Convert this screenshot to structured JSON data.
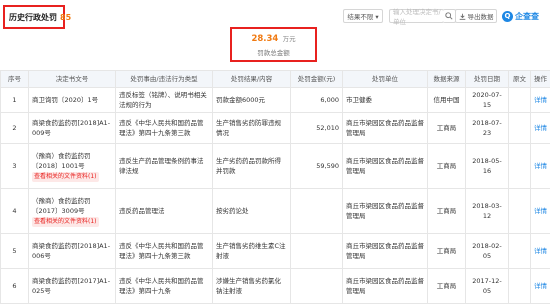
{
  "header": {
    "title": "历史行政处罚",
    "count": "85",
    "sort_label": "结果不限 ▾",
    "search_placeholder": "输入处理决定书/单位",
    "search_icon": "search-icon",
    "export_label": "导出数据",
    "logo_text": "企查查"
  },
  "summary": {
    "amount": "28.34",
    "unit": "万元",
    "label": "罚款总金额"
  },
  "table": {
    "columns": [
      "序号",
      "决定书文号",
      "处罚事由/违法行为类型",
      "处罚结果/内容",
      "处罚金额(元)",
      "处罚单位",
      "数据来源",
      "处罚日期",
      "原文",
      "操作"
    ],
    "rows": [
      {
        "no": "1",
        "doc": "商卫询罚〔2020〕1号",
        "doc_tag": "",
        "reason": "违反标签（铭牌）、说明书相关法规的行为",
        "result": "罚款金额6000元",
        "amount": "6,000",
        "unit": "市卫健委",
        "source": "信用中国",
        "date": "2020-07-15",
        "orig": "",
        "op": "详情"
      },
      {
        "no": "2",
        "doc": "商梁食药监药罚[2018]A1-009号",
        "doc_tag": "",
        "reason": "违反《中华人民共和国药品管理法》第四十九条第三款",
        "result": "生产销售劣药防罪违规情况",
        "amount": "52,010",
        "unit": "商丘市梁园区食品药品监督管理局",
        "source": "工商局",
        "date": "2018-07-23",
        "orig": "",
        "op": "详情"
      },
      {
        "no": "3",
        "doc": "（豫商）食药监药罚〔2018〕1001号",
        "doc_tag": "查看相关的文件资料(1)",
        "reason": "违反生产药品管理条例药事法律法规",
        "result": "生产劣药药品罚款所得并罚款",
        "amount": "59,590",
        "unit": "商丘市梁园区食品药品监督管理局",
        "source": "工商局",
        "date": "2018-05-16",
        "orig": "",
        "op": "详情"
      },
      {
        "no": "4",
        "doc": "（豫商）食药监药罚〔2017〕3009号",
        "doc_tag": "查看相关的文件资料(1)",
        "reason": "违反药品管理法",
        "result": "按劣药论处",
        "amount": "",
        "unit": "商丘市梁园区食品药品监督管理局",
        "source": "工商局",
        "date": "2018-03-12",
        "orig": "",
        "op": "详情"
      },
      {
        "no": "5",
        "doc": "商梁食药监药罚[2018]A1-006号",
        "doc_tag": "",
        "reason": "违反《中华人民共和国药品管理法》第四十九条第三款",
        "result": "生产销售劣药维生素C注射液",
        "amount": "",
        "unit": "商丘市梁园区食品药品监督管理局",
        "source": "工商局",
        "date": "2018-02-05",
        "orig": "",
        "op": "详情"
      },
      {
        "no": "6",
        "doc": "商梁食药监药罚[2017]A1-025号",
        "doc_tag": "",
        "reason": "违反《中华人民共和国药品管理法》第四十九条",
        "result": "涉嫌生产销售劣药氯化钠注射液",
        "amount": "",
        "unit": "商丘市梁园区食品药品监督管理局",
        "source": "工商局",
        "date": "2017-12-05",
        "orig": "",
        "op": "详情"
      }
    ]
  }
}
